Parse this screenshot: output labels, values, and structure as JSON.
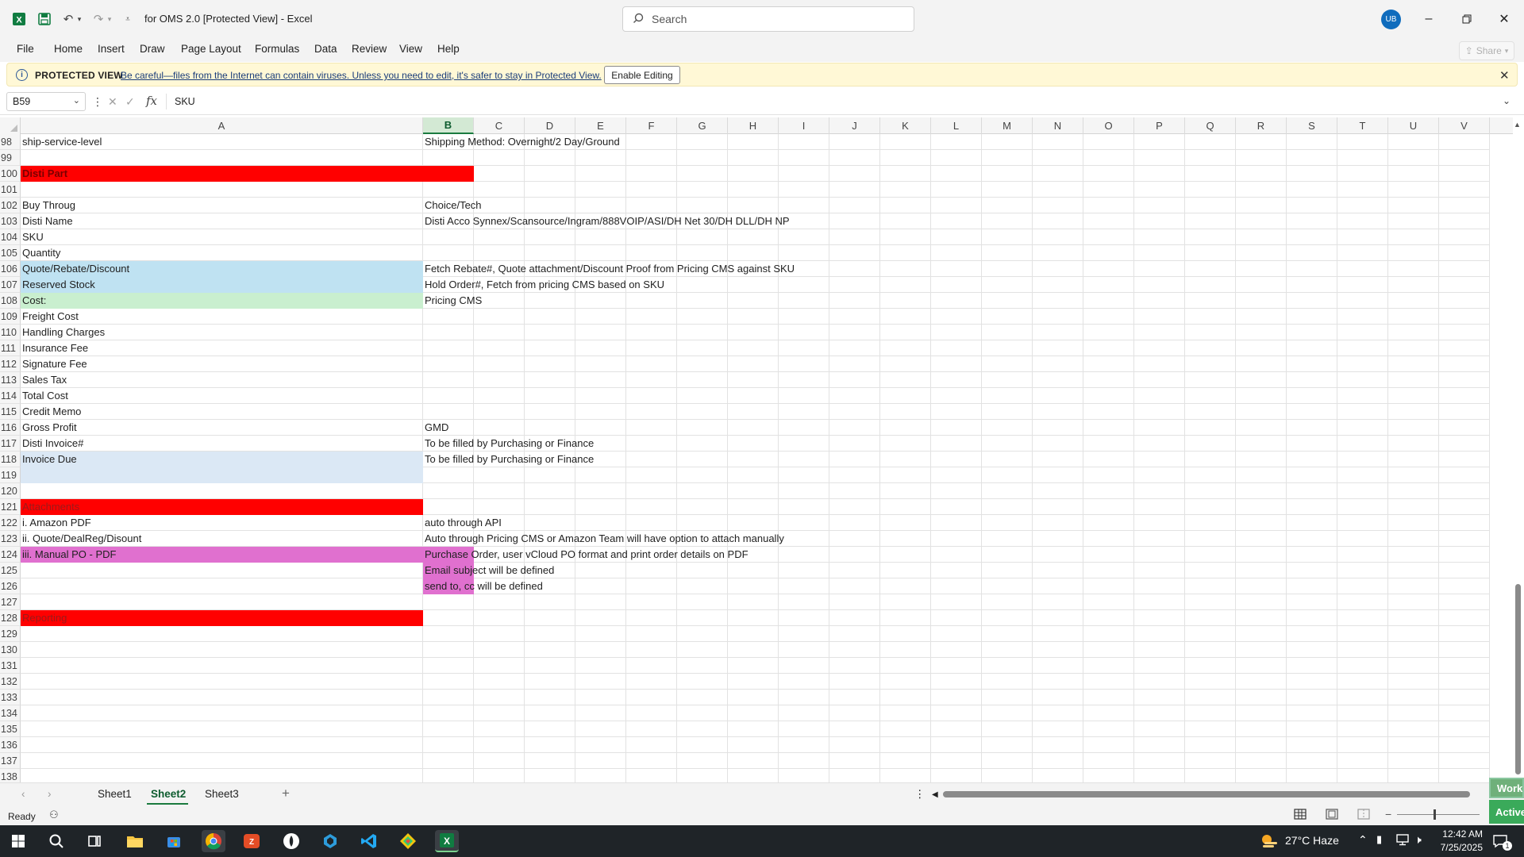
{
  "titlebar": {
    "doc_title": "for OMS 2.0  [Protected View]  -  Excel",
    "search_placeholder": "Search",
    "avatar_initials": "UB"
  },
  "ribbon": {
    "tabs": [
      "File",
      "Home",
      "Insert",
      "Draw",
      "Page Layout",
      "Formulas",
      "Data",
      "Review",
      "View",
      "Help"
    ],
    "share_label": "Share"
  },
  "protected_view": {
    "label": "PROTECTED VIEW",
    "message": "Be careful—files from the Internet can contain viruses. Unless you need to edit, it's safer to stay in Protected View.",
    "enable_button": "Enable Editing"
  },
  "formula_bar": {
    "name_box": "B59",
    "fx": "fx",
    "formula": "SKU"
  },
  "columns": [
    "A",
    "B",
    "C",
    "D",
    "E",
    "F",
    "G",
    "H",
    "I",
    "J",
    "K",
    "L",
    "M",
    "N",
    "O",
    "P",
    "Q",
    "R",
    "S",
    "T",
    "U",
    "V"
  ],
  "selected_column": "B",
  "colors": {
    "red": "#ff0000",
    "light_blue": "#bfe2f2",
    "light_green": "#c9efcf",
    "pale_blue": "#dbe8f5",
    "magenta": "#e070cf",
    "accent": "#1a7a3f"
  },
  "rows": [
    {
      "n": "98",
      "a": "ship-service-level",
      "b": "Shipping Method: Overnight/2 Day/Ground",
      "fill": ""
    },
    {
      "n": "99",
      "a": "",
      "b": "",
      "fill": ""
    },
    {
      "n": "100",
      "a": "Disti Part",
      "b": "",
      "fill": "red-ab"
    },
    {
      "n": "101",
      "a": "",
      "b": "",
      "fill": ""
    },
    {
      "n": "102",
      "a": "Buy Throug",
      "b": "Choice/Tech",
      "fill": ""
    },
    {
      "n": "103",
      "a": "Disti Name",
      "b": "Disti Acco Synnex/Scansource/Ingram/888VOIP/ASI/DH Net 30/DH DLL/DH NP",
      "fill": ""
    },
    {
      "n": "104",
      "a": "SKU",
      "b": "",
      "fill": ""
    },
    {
      "n": "105",
      "a": "Quantity",
      "b": "",
      "fill": ""
    },
    {
      "n": "106",
      "a": "Quote/Rebate/Discount",
      "b": "Fetch Rebate#, Quote attachment/Discount Proof from Pricing CMS against SKU",
      "fill": "light-blue-a"
    },
    {
      "n": "107",
      "a": "Reserved Stock",
      "b": "Hold Order#, Fetch from pricing CMS based on SKU",
      "fill": "light-blue-a"
    },
    {
      "n": "108",
      "a": "Cost:",
      "b": "Pricing CMS",
      "fill": "light-green-a"
    },
    {
      "n": "109",
      "a": "Freight Cost",
      "b": "",
      "fill": ""
    },
    {
      "n": "110",
      "a": "Handling Charges",
      "b": "",
      "fill": ""
    },
    {
      "n": "111",
      "a": "Insurance Fee",
      "b": "",
      "fill": ""
    },
    {
      "n": "112",
      "a": "Signature Fee",
      "b": "",
      "fill": ""
    },
    {
      "n": "113",
      "a": "Sales Tax",
      "b": "",
      "fill": ""
    },
    {
      "n": "114",
      "a": "Total Cost",
      "b": "",
      "fill": ""
    },
    {
      "n": "115",
      "a": "Credit Memo",
      "b": "",
      "fill": ""
    },
    {
      "n": "116",
      "a": "Gross Profit",
      "b": "GMD",
      "fill": ""
    },
    {
      "n": "117",
      "a": "Disti Invoice#",
      "b": "To be filled by Purchasing or Finance",
      "fill": ""
    },
    {
      "n": "118",
      "a": "Invoice Due",
      "b": "To be filled by Purchasing or Finance",
      "fill": "pale-blue-a"
    },
    {
      "n": "119",
      "a": "",
      "b": "",
      "fill": "pale-blue-a"
    },
    {
      "n": "120",
      "a": "",
      "b": "",
      "fill": ""
    },
    {
      "n": "121",
      "a": "Attachments",
      "b": "",
      "fill": "red-a"
    },
    {
      "n": "122",
      "a": "i. Amazon PDF",
      "b": "auto through API",
      "fill": ""
    },
    {
      "n": "123",
      "a": "ii. Quote/DealReg/Disount",
      "b": "Auto through Pricing CMS or Amazon Team will have option to attach manually",
      "fill": ""
    },
    {
      "n": "124",
      "a": "iii. Manual PO - PDF",
      "b": "Purchase Order, user vCloud PO format and print order details on PDF",
      "fill": "magenta-ab"
    },
    {
      "n": "125",
      "a": "",
      "b": "Email subject will be defined",
      "fill": "magenta-b"
    },
    {
      "n": "126",
      "a": "",
      "b": "send to, cc will be defined",
      "fill": "magenta-b"
    },
    {
      "n": "127",
      "a": "",
      "b": "",
      "fill": ""
    },
    {
      "n": "128",
      "a": "Reporting",
      "b": "",
      "fill": "red-a"
    },
    {
      "n": "129",
      "a": "",
      "b": "",
      "fill": ""
    },
    {
      "n": "130",
      "a": "",
      "b": "",
      "fill": ""
    },
    {
      "n": "131",
      "a": "",
      "b": "",
      "fill": ""
    },
    {
      "n": "132",
      "a": "",
      "b": "",
      "fill": ""
    },
    {
      "n": "133",
      "a": "",
      "b": "",
      "fill": ""
    },
    {
      "n": "134",
      "a": "",
      "b": "",
      "fill": ""
    },
    {
      "n": "135",
      "a": "",
      "b": "",
      "fill": ""
    },
    {
      "n": "136",
      "a": "",
      "b": "",
      "fill": ""
    },
    {
      "n": "137",
      "a": "",
      "b": "",
      "fill": ""
    },
    {
      "n": "138",
      "a": "",
      "b": "",
      "fill": ""
    }
  ],
  "sheets": [
    "Sheet1",
    "Sheet2",
    "Sheet3"
  ],
  "active_sheet": "Sheet2",
  "status": {
    "ready": "Ready",
    "overlay_work": "Work",
    "overlay_active": "Active"
  },
  "taskbar": {
    "weather": "27°C  Haze",
    "time": "12:42 AM",
    "date": "7/25/2025",
    "notification_count": "1"
  }
}
